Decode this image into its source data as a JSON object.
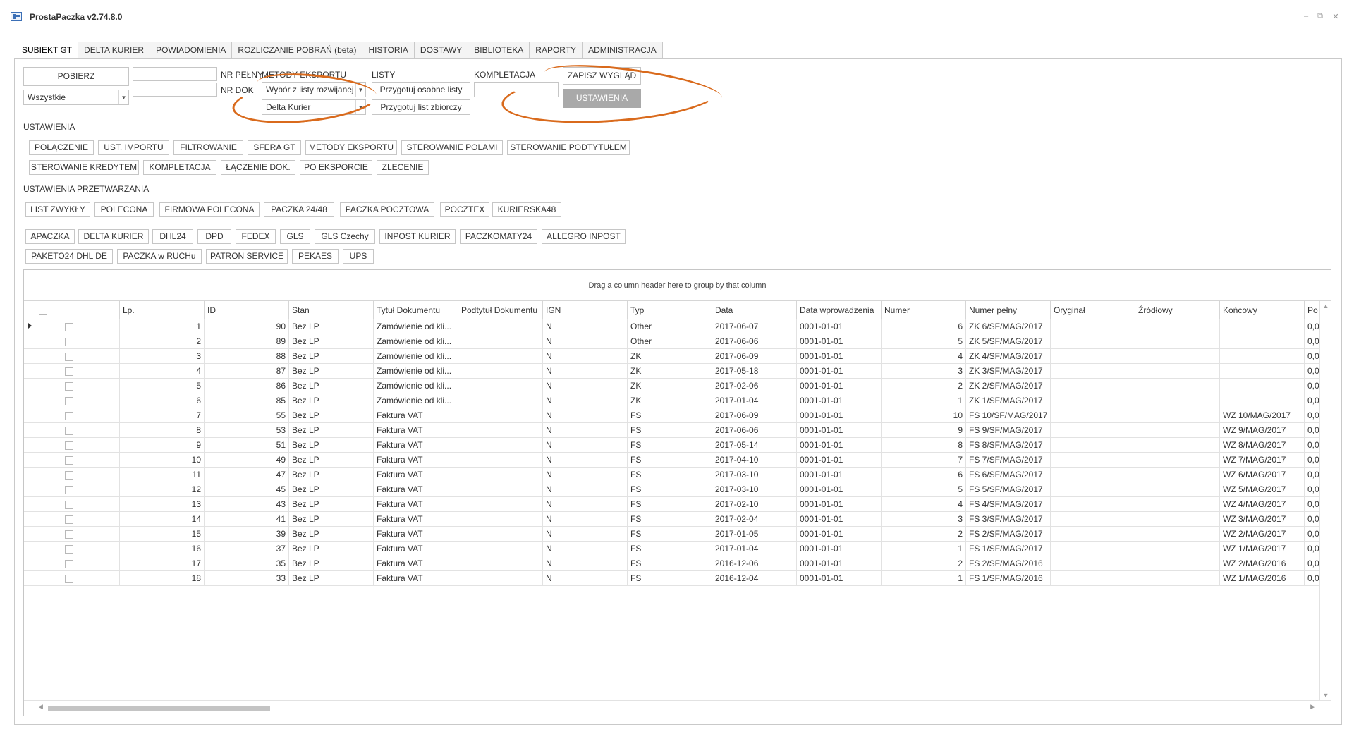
{
  "window": {
    "title": "ProstaPaczka v2.74.8.0",
    "minimize": "–",
    "restore": "⧉",
    "close": "✕"
  },
  "tabs": [
    "SUBIEKT GT",
    "DELTA KURIER",
    "POWIADOMIENIA",
    "ROZLICZANIE POBRAŃ (beta)",
    "HISTORIA",
    "DOSTAWY",
    "BIBLIOTEKA",
    "RAPORTY",
    "ADMINISTRACJA"
  ],
  "toolbar": {
    "pobierz": "POBIERZ",
    "filter_value": "Wszystkie",
    "nr_pelny": "NR PEŁNY",
    "nr_dok": "NR DOK",
    "metody_eksportu_label": "METODY EKSPORTU",
    "metody_eksportu_value": "Wybór z listy rozwijanej",
    "kurier_value": "Delta Kurier",
    "listy_label": "LISTY",
    "przygotuj_osobne": "Przygotuj osobne listy",
    "przygotuj_zbiorczy": "Przygotuj list zbiorczy",
    "kompletacja_label": "KOMPLETACJA",
    "zapisz_wyglad": "ZAPISZ WYGLĄD",
    "ustawienia": "USTAWIENIA"
  },
  "settings": {
    "label": "USTAWIENIA",
    "row1": [
      "POŁĄCZENIE",
      "UST. IMPORTU",
      "FILTROWANIE",
      "SFERA GT",
      "METODY EKSPORTU",
      "STEROWANIE POLAMI",
      "STEROWANIE PODTYTUŁEM"
    ],
    "row2": [
      "STEROWANIE KREDYTEM",
      "KOMPLETACJA",
      "ŁĄCZENIE DOK.",
      "PO EKSPORCIE",
      "ZLECENIE"
    ]
  },
  "processing": {
    "label": "USTAWIENIA PRZETWARZANIA",
    "row1": [
      "LIST ZWYKŁY",
      "POLECONA",
      "FIRMOWA POLECONA",
      "PACZKA 24/48",
      "PACZKA POCZTOWA",
      "POCZTEX",
      "KURIERSKA48"
    ],
    "row2": [
      "APACZKA",
      "DELTA KURIER",
      "DHL24",
      "DPD",
      "FEDEX",
      "GLS",
      "GLS Czechy",
      "INPOST KURIER",
      "PACZKOMATY24",
      "ALLEGRO INPOST"
    ],
    "row3": [
      "PAKETO24 DHL DE",
      "PACZKA w RUCHu",
      "PATRON SERVICE",
      "PEKAES",
      "UPS"
    ]
  },
  "grid": {
    "group_hint": "Drag a column header here to group by that column",
    "columns": [
      "Lp.",
      "ID",
      "Stan",
      "Tytuł Dokumentu",
      "Podtytuł Dokumentu",
      "IGN",
      "Typ",
      "Data",
      "Data wprowadzenia",
      "Numer",
      "Numer pełny",
      "Oryginał",
      "Źródłowy",
      "Końcowy",
      "Po"
    ],
    "rows": [
      {
        "lp": "1",
        "id": "90",
        "stan": "Bez LP",
        "tytul": "Zamówienie od kli...",
        "podtytul": "",
        "ign": "N",
        "typ": "Other",
        "data": "2017-06-07",
        "data_wpr": "0001-01-01",
        "numer": "6",
        "numer_pelny": "ZK 6/SF/MAG/2017",
        "oryginal": "",
        "zrodlowy": "",
        "koncowy": "",
        "po": "0,0"
      },
      {
        "lp": "2",
        "id": "89",
        "stan": "Bez LP",
        "tytul": "Zamówienie od kli...",
        "podtytul": "",
        "ign": "N",
        "typ": "Other",
        "data": "2017-06-06",
        "data_wpr": "0001-01-01",
        "numer": "5",
        "numer_pelny": "ZK 5/SF/MAG/2017",
        "oryginal": "",
        "zrodlowy": "",
        "koncowy": "",
        "po": "0,0"
      },
      {
        "lp": "3",
        "id": "88",
        "stan": "Bez LP",
        "tytul": "Zamówienie od kli...",
        "podtytul": "",
        "ign": "N",
        "typ": "ZK",
        "data": "2017-06-09",
        "data_wpr": "0001-01-01",
        "numer": "4",
        "numer_pelny": "ZK 4/SF/MAG/2017",
        "oryginal": "",
        "zrodlowy": "",
        "koncowy": "",
        "po": "0,0"
      },
      {
        "lp": "4",
        "id": "87",
        "stan": "Bez LP",
        "tytul": "Zamówienie od kli...",
        "podtytul": "",
        "ign": "N",
        "typ": "ZK",
        "data": "2017-05-18",
        "data_wpr": "0001-01-01",
        "numer": "3",
        "numer_pelny": "ZK 3/SF/MAG/2017",
        "oryginal": "",
        "zrodlowy": "",
        "koncowy": "",
        "po": "0,0"
      },
      {
        "lp": "5",
        "id": "86",
        "stan": "Bez LP",
        "tytul": "Zamówienie od kli...",
        "podtytul": "",
        "ign": "N",
        "typ": "ZK",
        "data": "2017-02-06",
        "data_wpr": "0001-01-01",
        "numer": "2",
        "numer_pelny": "ZK 2/SF/MAG/2017",
        "oryginal": "",
        "zrodlowy": "",
        "koncowy": "",
        "po": "0,0"
      },
      {
        "lp": "6",
        "id": "85",
        "stan": "Bez LP",
        "tytul": "Zamówienie od kli...",
        "podtytul": "",
        "ign": "N",
        "typ": "ZK",
        "data": "2017-01-04",
        "data_wpr": "0001-01-01",
        "numer": "1",
        "numer_pelny": "ZK 1/SF/MAG/2017",
        "oryginal": "",
        "zrodlowy": "",
        "koncowy": "",
        "po": "0,0"
      },
      {
        "lp": "7",
        "id": "55",
        "stan": "Bez LP",
        "tytul": "Faktura VAT",
        "podtytul": "",
        "ign": "N",
        "typ": "FS",
        "data": "2017-06-09",
        "data_wpr": "0001-01-01",
        "numer": "10",
        "numer_pelny": "FS 10/SF/MAG/2017",
        "oryginal": "",
        "zrodlowy": "",
        "koncowy": "WZ 10/MAG/2017",
        "po": "0,0"
      },
      {
        "lp": "8",
        "id": "53",
        "stan": "Bez LP",
        "tytul": "Faktura VAT",
        "podtytul": "",
        "ign": "N",
        "typ": "FS",
        "data": "2017-06-06",
        "data_wpr": "0001-01-01",
        "numer": "9",
        "numer_pelny": "FS 9/SF/MAG/2017",
        "oryginal": "",
        "zrodlowy": "",
        "koncowy": "WZ 9/MAG/2017",
        "po": "0,0"
      },
      {
        "lp": "9",
        "id": "51",
        "stan": "Bez LP",
        "tytul": "Faktura VAT",
        "podtytul": "",
        "ign": "N",
        "typ": "FS",
        "data": "2017-05-14",
        "data_wpr": "0001-01-01",
        "numer": "8",
        "numer_pelny": "FS 8/SF/MAG/2017",
        "oryginal": "",
        "zrodlowy": "",
        "koncowy": "WZ 8/MAG/2017",
        "po": "0,0"
      },
      {
        "lp": "10",
        "id": "49",
        "stan": "Bez LP",
        "tytul": "Faktura VAT",
        "podtytul": "",
        "ign": "N",
        "typ": "FS",
        "data": "2017-04-10",
        "data_wpr": "0001-01-01",
        "numer": "7",
        "numer_pelny": "FS 7/SF/MAG/2017",
        "oryginal": "",
        "zrodlowy": "",
        "koncowy": "WZ 7/MAG/2017",
        "po": "0,0"
      },
      {
        "lp": "11",
        "id": "47",
        "stan": "Bez LP",
        "tytul": "Faktura VAT",
        "podtytul": "",
        "ign": "N",
        "typ": "FS",
        "data": "2017-03-10",
        "data_wpr": "0001-01-01",
        "numer": "6",
        "numer_pelny": "FS 6/SF/MAG/2017",
        "oryginal": "",
        "zrodlowy": "",
        "koncowy": "WZ 6/MAG/2017",
        "po": "0,0"
      },
      {
        "lp": "12",
        "id": "45",
        "stan": "Bez LP",
        "tytul": "Faktura VAT",
        "podtytul": "",
        "ign": "N",
        "typ": "FS",
        "data": "2017-03-10",
        "data_wpr": "0001-01-01",
        "numer": "5",
        "numer_pelny": "FS 5/SF/MAG/2017",
        "oryginal": "",
        "zrodlowy": "",
        "koncowy": "WZ 5/MAG/2017",
        "po": "0,0"
      },
      {
        "lp": "13",
        "id": "43",
        "stan": "Bez LP",
        "tytul": "Faktura VAT",
        "podtytul": "",
        "ign": "N",
        "typ": "FS",
        "data": "2017-02-10",
        "data_wpr": "0001-01-01",
        "numer": "4",
        "numer_pelny": "FS 4/SF/MAG/2017",
        "oryginal": "",
        "zrodlowy": "",
        "koncowy": "WZ 4/MAG/2017",
        "po": "0,0"
      },
      {
        "lp": "14",
        "id": "41",
        "stan": "Bez LP",
        "tytul": "Faktura VAT",
        "podtytul": "",
        "ign": "N",
        "typ": "FS",
        "data": "2017-02-04",
        "data_wpr": "0001-01-01",
        "numer": "3",
        "numer_pelny": "FS 3/SF/MAG/2017",
        "oryginal": "",
        "zrodlowy": "",
        "koncowy": "WZ 3/MAG/2017",
        "po": "0,0"
      },
      {
        "lp": "15",
        "id": "39",
        "stan": "Bez LP",
        "tytul": "Faktura VAT",
        "podtytul": "",
        "ign": "N",
        "typ": "FS",
        "data": "2017-01-05",
        "data_wpr": "0001-01-01",
        "numer": "2",
        "numer_pelny": "FS 2/SF/MAG/2017",
        "oryginal": "",
        "zrodlowy": "",
        "koncowy": "WZ 2/MAG/2017",
        "po": "0,0"
      },
      {
        "lp": "16",
        "id": "37",
        "stan": "Bez LP",
        "tytul": "Faktura VAT",
        "podtytul": "",
        "ign": "N",
        "typ": "FS",
        "data": "2017-01-04",
        "data_wpr": "0001-01-01",
        "numer": "1",
        "numer_pelny": "FS 1/SF/MAG/2017",
        "oryginal": "",
        "zrodlowy": "",
        "koncowy": "WZ 1/MAG/2017",
        "po": "0,0"
      },
      {
        "lp": "17",
        "id": "35",
        "stan": "Bez LP",
        "tytul": "Faktura VAT",
        "podtytul": "",
        "ign": "N",
        "typ": "FS",
        "data": "2016-12-06",
        "data_wpr": "0001-01-01",
        "numer": "2",
        "numer_pelny": "FS 2/SF/MAG/2016",
        "oryginal": "",
        "zrodlowy": "",
        "koncowy": "WZ 2/MAG/2016",
        "po": "0,0"
      },
      {
        "lp": "18",
        "id": "33",
        "stan": "Bez LP",
        "tytul": "Faktura VAT",
        "podtytul": "",
        "ign": "N",
        "typ": "FS",
        "data": "2016-12-04",
        "data_wpr": "0001-01-01",
        "numer": "1",
        "numer_pelny": "FS 1/SF/MAG/2016",
        "oryginal": "",
        "zrodlowy": "",
        "koncowy": "WZ 1/MAG/2016",
        "po": "0,0"
      }
    ]
  },
  "colors": {
    "accent_ellipse": "#d96a1c",
    "button_gray": "#a9a9a9"
  }
}
